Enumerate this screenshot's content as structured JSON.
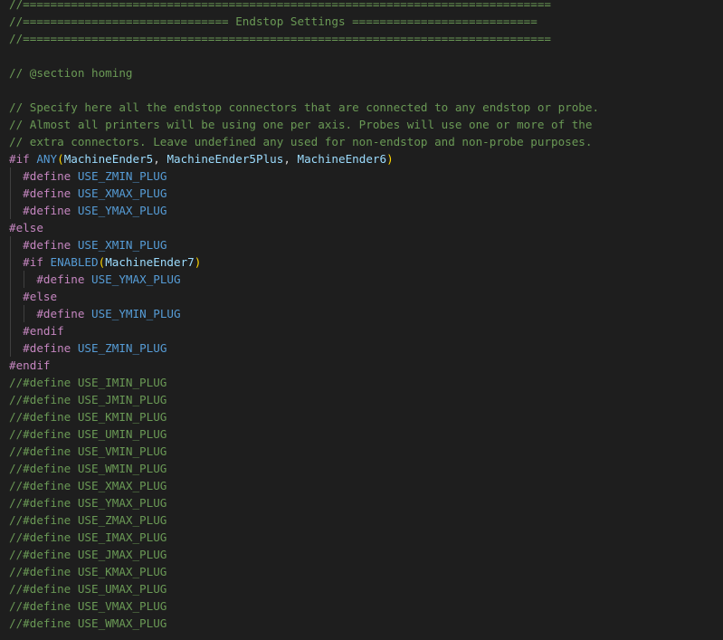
{
  "editor": {
    "lines": [
      {
        "indent": 0,
        "parts": [
          {
            "cls": "c",
            "text": "//============================================================================="
          }
        ]
      },
      {
        "indent": 0,
        "parts": [
          {
            "cls": "c",
            "text": "//============================== Endstop Settings ==========================="
          }
        ]
      },
      {
        "indent": 0,
        "parts": [
          {
            "cls": "c",
            "text": "//============================================================================="
          }
        ]
      },
      {
        "indent": 0,
        "parts": []
      },
      {
        "indent": 0,
        "parts": [
          {
            "cls": "c",
            "text": "// @section homing"
          }
        ]
      },
      {
        "indent": 0,
        "parts": []
      },
      {
        "indent": 0,
        "parts": [
          {
            "cls": "c",
            "text": "// Specify here all the endstop connectors that are connected to any endstop or probe."
          }
        ]
      },
      {
        "indent": 0,
        "parts": [
          {
            "cls": "c",
            "text": "// Almost all printers will be using one per axis. Probes will use one or more of the"
          }
        ]
      },
      {
        "indent": 0,
        "parts": [
          {
            "cls": "c",
            "text": "// extra connectors. Leave undefined any used for non-endstop and non-probe purposes."
          }
        ]
      },
      {
        "indent": 0,
        "parts": [
          {
            "cls": "pp",
            "text": "#if "
          },
          {
            "cls": "fn",
            "text": "ANY"
          },
          {
            "cls": "pn",
            "text": "("
          },
          {
            "cls": "id",
            "text": "MachineEnder5"
          },
          {
            "cls": "pt",
            "text": ", "
          },
          {
            "cls": "id",
            "text": "MachineEnder5Plus"
          },
          {
            "cls": "pt",
            "text": ", "
          },
          {
            "cls": "id",
            "text": "MachineEnder6"
          },
          {
            "cls": "pn",
            "text": ")"
          }
        ]
      },
      {
        "indent": 1,
        "parts": [
          {
            "cls": "pp",
            "text": "#define "
          },
          {
            "cls": "mac",
            "text": "USE_ZMIN_PLUG"
          }
        ]
      },
      {
        "indent": 1,
        "parts": [
          {
            "cls": "pp",
            "text": "#define "
          },
          {
            "cls": "mac",
            "text": "USE_XMAX_PLUG"
          }
        ]
      },
      {
        "indent": 1,
        "parts": [
          {
            "cls": "pp",
            "text": "#define "
          },
          {
            "cls": "mac",
            "text": "USE_YMAX_PLUG"
          }
        ]
      },
      {
        "indent": 0,
        "parts": [
          {
            "cls": "pp",
            "text": "#else"
          }
        ]
      },
      {
        "indent": 1,
        "parts": [
          {
            "cls": "pp",
            "text": "#define "
          },
          {
            "cls": "mac",
            "text": "USE_XMIN_PLUG"
          }
        ]
      },
      {
        "indent": 1,
        "parts": [
          {
            "cls": "pp",
            "text": "#if "
          },
          {
            "cls": "fn",
            "text": "ENABLED"
          },
          {
            "cls": "pn",
            "text": "("
          },
          {
            "cls": "id",
            "text": "MachineEnder7"
          },
          {
            "cls": "pn",
            "text": ")"
          }
        ]
      },
      {
        "indent": 2,
        "parts": [
          {
            "cls": "pp",
            "text": "#define "
          },
          {
            "cls": "mac",
            "text": "USE_YMAX_PLUG"
          }
        ]
      },
      {
        "indent": 1,
        "parts": [
          {
            "cls": "pp",
            "text": "#else"
          }
        ]
      },
      {
        "indent": 2,
        "parts": [
          {
            "cls": "pp",
            "text": "#define "
          },
          {
            "cls": "mac",
            "text": "USE_YMIN_PLUG"
          }
        ]
      },
      {
        "indent": 1,
        "parts": [
          {
            "cls": "pp",
            "text": "#endif"
          }
        ]
      },
      {
        "indent": 1,
        "parts": [
          {
            "cls": "pp",
            "text": "#define "
          },
          {
            "cls": "mac",
            "text": "USE_ZMIN_PLUG"
          }
        ]
      },
      {
        "indent": 0,
        "parts": [
          {
            "cls": "pp",
            "text": "#endif"
          }
        ]
      },
      {
        "indent": 0,
        "parts": [
          {
            "cls": "c",
            "text": "//#define USE_IMIN_PLUG"
          }
        ]
      },
      {
        "indent": 0,
        "parts": [
          {
            "cls": "c",
            "text": "//#define USE_JMIN_PLUG"
          }
        ]
      },
      {
        "indent": 0,
        "parts": [
          {
            "cls": "c",
            "text": "//#define USE_KMIN_PLUG"
          }
        ]
      },
      {
        "indent": 0,
        "parts": [
          {
            "cls": "c",
            "text": "//#define USE_UMIN_PLUG"
          }
        ]
      },
      {
        "indent": 0,
        "parts": [
          {
            "cls": "c",
            "text": "//#define USE_VMIN_PLUG"
          }
        ]
      },
      {
        "indent": 0,
        "parts": [
          {
            "cls": "c",
            "text": "//#define USE_WMIN_PLUG"
          }
        ]
      },
      {
        "indent": 0,
        "parts": [
          {
            "cls": "c",
            "text": "//#define USE_XMAX_PLUG"
          }
        ]
      },
      {
        "indent": 0,
        "parts": [
          {
            "cls": "c",
            "text": "//#define USE_YMAX_PLUG"
          }
        ]
      },
      {
        "indent": 0,
        "parts": [
          {
            "cls": "c",
            "text": "//#define USE_ZMAX_PLUG"
          }
        ]
      },
      {
        "indent": 0,
        "parts": [
          {
            "cls": "c",
            "text": "//#define USE_IMAX_PLUG"
          }
        ]
      },
      {
        "indent": 0,
        "parts": [
          {
            "cls": "c",
            "text": "//#define USE_JMAX_PLUG"
          }
        ]
      },
      {
        "indent": 0,
        "parts": [
          {
            "cls": "c",
            "text": "//#define USE_KMAX_PLUG"
          }
        ]
      },
      {
        "indent": 0,
        "parts": [
          {
            "cls": "c",
            "text": "//#define USE_UMAX_PLUG"
          }
        ]
      },
      {
        "indent": 0,
        "parts": [
          {
            "cls": "c",
            "text": "//#define USE_VMAX_PLUG"
          }
        ]
      },
      {
        "indent": 0,
        "parts": [
          {
            "cls": "c",
            "text": "//#define USE_WMAX_PLUG"
          }
        ]
      }
    ]
  },
  "colors": {
    "background": "#1e1e1e",
    "comment": "#6a9955",
    "preprocessor": "#c586c0",
    "macro": "#569cd6",
    "identifier": "#9cdcfe",
    "bracket": "#ffd700",
    "indent_guide": "#404040"
  }
}
